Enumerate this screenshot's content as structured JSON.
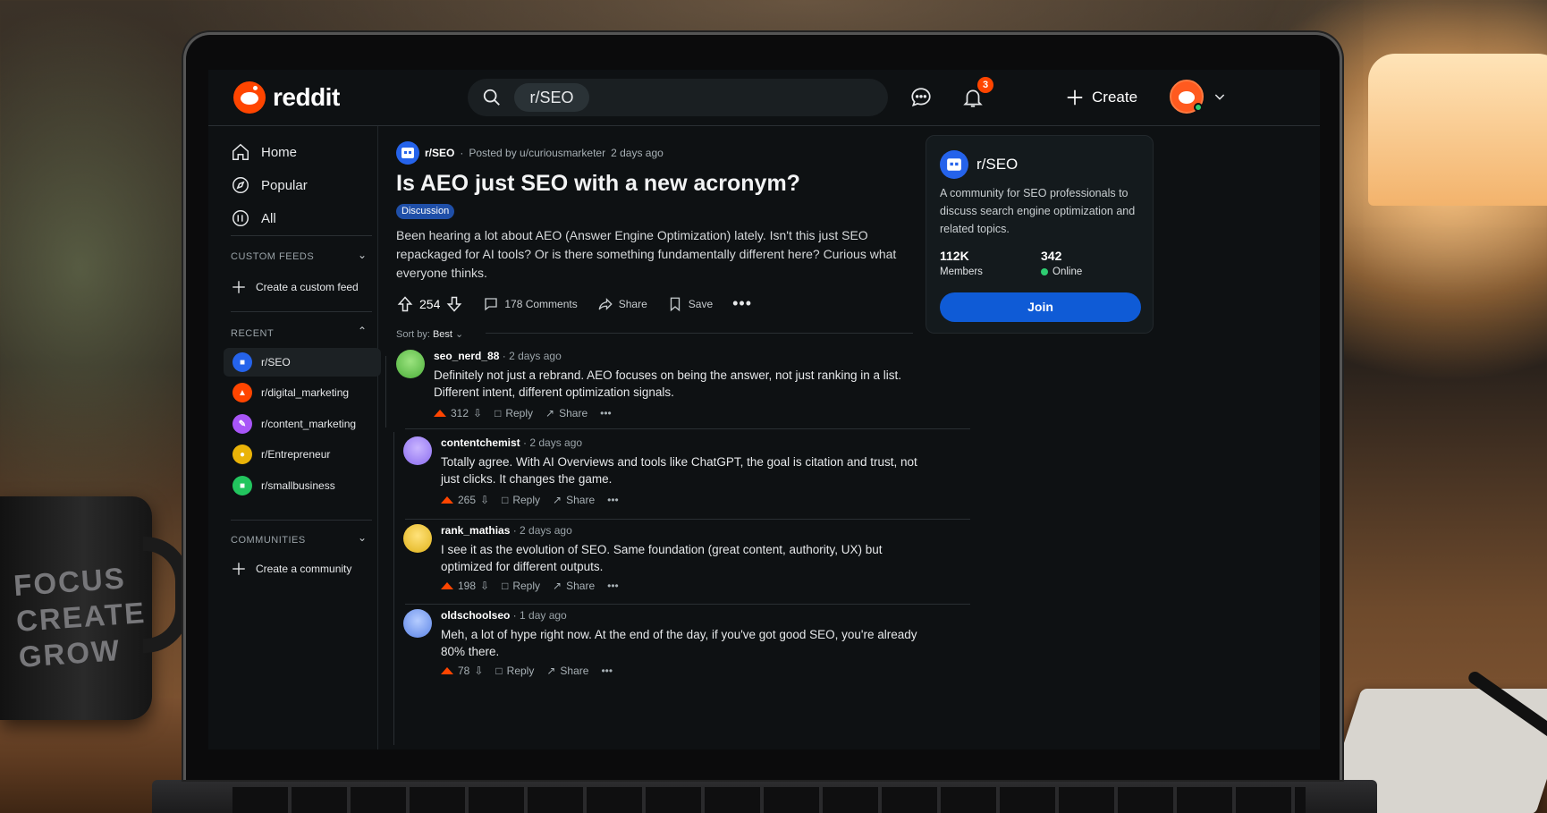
{
  "background": {
    "mug_text": [
      "FOCUS",
      "CREATE",
      "GROW"
    ]
  },
  "header": {
    "logo_text": "reddit",
    "search_chip": "r/SEO",
    "notification_count": "3",
    "create_label": "Create"
  },
  "sidebar": {
    "nav": [
      {
        "label": "Home",
        "icon": "home-icon"
      },
      {
        "label": "Popular",
        "icon": "compass-icon"
      },
      {
        "label": "All",
        "icon": "all-icon"
      }
    ],
    "custom_feeds": {
      "title": "CUSTOM FEEDS",
      "create_label": "Create a custom feed"
    },
    "recent": {
      "title": "RECENT",
      "items": [
        {
          "label": "r/SEO",
          "color": "#2563eb"
        },
        {
          "label": "r/digital_marketing",
          "color": "#ff4500"
        },
        {
          "label": "r/content_marketing",
          "color": "#a855f7"
        },
        {
          "label": "r/Entrepreneur",
          "color": "#eab308"
        },
        {
          "label": "r/smallbusiness",
          "color": "#22c55e"
        }
      ]
    },
    "communities": {
      "title": "COMMUNITIES",
      "create_label": "Create a community"
    }
  },
  "post": {
    "subreddit": "r/SEO",
    "posted_by": "Posted by u/curiousmarketer",
    "time": "2 days ago",
    "title": "Is AEO just SEO with a new acronym?",
    "flair": "Discussion",
    "body": "Been hearing a lot about AEO (Answer Engine Optimization) lately. Isn't this just SEO repackaged for AI tools? Or is there something fundamentally different here? Curious what everyone thinks.",
    "votes": "254",
    "comments_label": "178 Comments",
    "share_label": "Share",
    "save_label": "Save",
    "sort_label": "Sort by:",
    "sort_value": "Best"
  },
  "comments": [
    {
      "user": "seo_nerd_88",
      "time": "2 days ago",
      "text": "Definitely not just a rebrand. AEO focuses on being the answer, not just ranking in a list. Different intent, different optimization signals.",
      "votes": "312",
      "reply": "Reply",
      "share": "Share",
      "avatar_color": "#6fcf57"
    },
    {
      "user": "contentchemist",
      "time": "2 days ago",
      "text": "Totally agree. With AI Overviews and tools like ChatGPT, the goal is citation and trust, not just clicks. It changes the game.",
      "votes": "265",
      "reply": "Reply",
      "share": "Share",
      "avatar_color": "#a78bfa"
    },
    {
      "user": "rank_mathias",
      "time": "2 days ago",
      "text": "I see it as the evolution of SEO. Same foundation (great content, authority, UX) but optimized for different outputs.",
      "votes": "198",
      "reply": "Reply",
      "share": "Share",
      "avatar_color": "#facc15"
    },
    {
      "user": "oldschoolseo",
      "time": "1 day ago",
      "text": "Meh, a lot of hype right now. At the end of the day, if you've got good SEO, you're already 80% there.",
      "votes": "78",
      "reply": "Reply",
      "share": "Share",
      "avatar_color": "#7aa2f7"
    }
  ],
  "community_card": {
    "name": "r/SEO",
    "description": "A community for SEO professionals to discuss search engine optimization and related topics.",
    "members": "112K",
    "members_label": "Members",
    "online": "342",
    "online_label": "Online",
    "join_label": "Join"
  }
}
